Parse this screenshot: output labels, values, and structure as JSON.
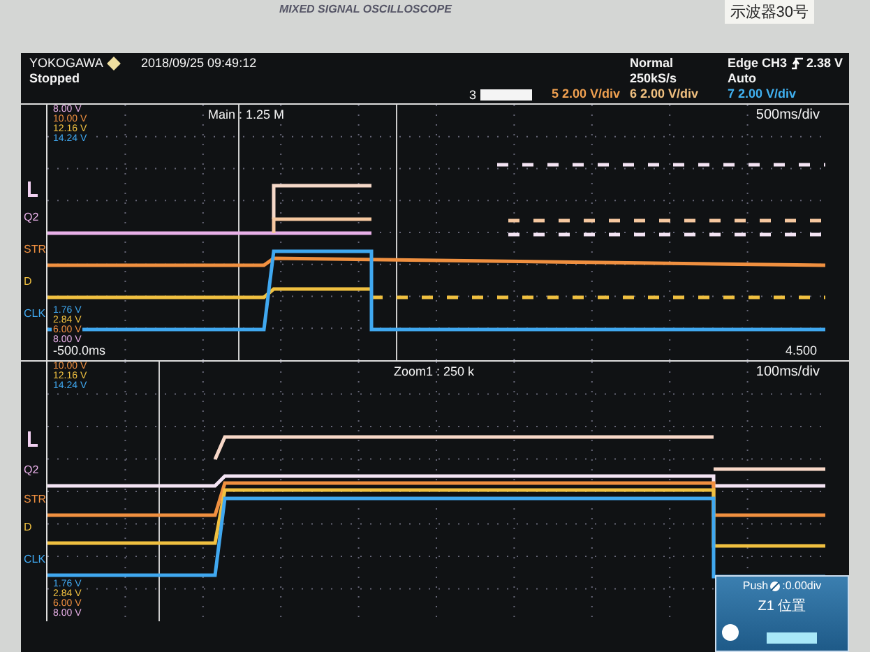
{
  "bezel": {
    "model": "MIXED SIGNAL OSCILLOSCOPE",
    "label": "示波器30号"
  },
  "header": {
    "brand": "YOKOGAWA",
    "datetime": "2018/09/25 09:49:12",
    "status": "Stopped",
    "mode": "Normal",
    "sample_rate": "250kS/s",
    "trigger_source": "Edge CH3",
    "trigger_level": "2.38 V",
    "trigger_mode": "Auto",
    "record_marker": "3",
    "channel_scales": [
      {
        "text": "5 2.00 V/div",
        "color": "#f0a050"
      },
      {
        "text": "6 2.00 V/div",
        "color": "#f0c080"
      },
      {
        "text": "7 2.00 V/div",
        "color": "#40b0f0"
      }
    ]
  },
  "main": {
    "title": "Main : 1.25 M",
    "timebase": "500ms/div",
    "start": "-500.0ms",
    "end": "4.500",
    "top_readings": [
      {
        "text": "8.00 V",
        "color": "#e8b0e8"
      },
      {
        "text": "10.00 V",
        "color": "#f09040"
      },
      {
        "text": "12.16 V",
        "color": "#f0c040"
      },
      {
        "text": "14.24 V",
        "color": "#40a8f0"
      }
    ],
    "bottom_readings": [
      {
        "text": "1.76 V",
        "color": "#40a8f0"
      },
      {
        "text": "2.84 V",
        "color": "#f0c040"
      },
      {
        "text": "6.00 V",
        "color": "#f09040"
      },
      {
        "text": "8.00 V",
        "color": "#e8b0e8"
      }
    ],
    "channels": [
      {
        "name": "Q2",
        "color": "#e8b0e8"
      },
      {
        "name": "STR",
        "color": "#f09040"
      },
      {
        "name": "D",
        "color": "#f0c040"
      },
      {
        "name": "CLK",
        "color": "#40a8f0"
      }
    ]
  },
  "zoom": {
    "title": "Zoom1 : 250 k",
    "timebase": "100ms/div",
    "top_readings": [
      {
        "text": "10.00 V",
        "color": "#f09040"
      },
      {
        "text": "12.16 V",
        "color": "#f0c040"
      },
      {
        "text": "14.24 V",
        "color": "#40a8f0"
      }
    ],
    "bottom_readings": [
      {
        "text": "1.76 V",
        "color": "#40a8f0"
      },
      {
        "text": "2.84 V",
        "color": "#f0c040"
      },
      {
        "text": "6.00 V",
        "color": "#f09040"
      },
      {
        "text": "8.00 V",
        "color": "#e8b0e8"
      }
    ],
    "channels": [
      {
        "name": "Q2",
        "color": "#e8b0e8"
      },
      {
        "name": "STR",
        "color": "#f09040"
      },
      {
        "name": "D",
        "color": "#f0c040"
      },
      {
        "name": "CLK",
        "color": "#40a8f0"
      }
    ]
  },
  "popup": {
    "hint_prefix": "Push",
    "hint_suffix": ":0.00div",
    "title": "Z1 位置"
  }
}
